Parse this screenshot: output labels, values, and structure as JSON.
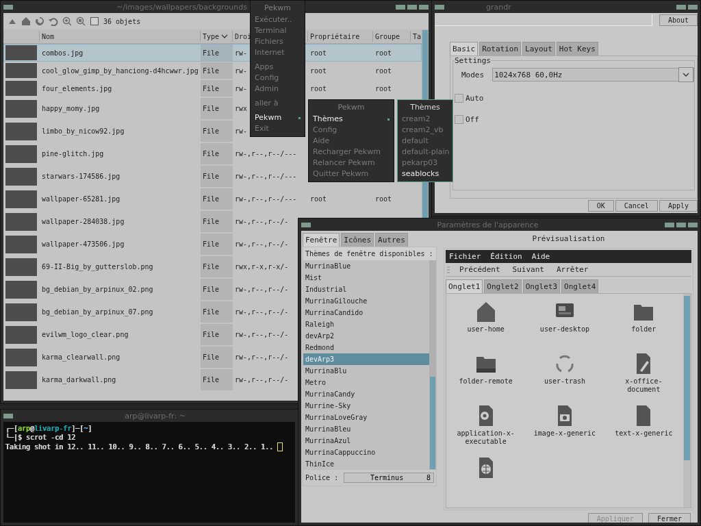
{
  "file_manager": {
    "title": "~/images/wallpapers/backgrounds",
    "count": "36 objets",
    "columns": [
      "Nom",
      "Type",
      "Droi",
      "Propriétaire",
      "Groupe",
      "Ta"
    ],
    "rows": [
      {
        "name": "combos.jpg",
        "type": "File",
        "rights": "rw-",
        "owner": "root",
        "group": "root",
        "selected": true
      },
      {
        "name": "cool_glow_gimp_by_hanciong-d4hcwwr.jpg",
        "type": "File",
        "rights": "rw-",
        "owner": "root",
        "group": "root",
        "selected": false
      },
      {
        "name": "four_elements.jpg",
        "type": "File",
        "rights": "rw-",
        "owner": "root",
        "group": "root",
        "selected": false
      },
      {
        "name": "happy_momy.jpg",
        "type": "File",
        "rights": "rwx",
        "selected": false
      },
      {
        "name": "limbo_by_nicow92.jpg",
        "type": "File",
        "rights": "rw-",
        "selected": false
      },
      {
        "name": "pine-glitch.jpg",
        "type": "File",
        "rights": "rw-,r--,r--/---",
        "selected": false
      },
      {
        "name": "starwars-174586.jpg",
        "type": "File",
        "rights": "rw-,r--,r--/---",
        "selected": false
      },
      {
        "name": "wallpaper-65281.jpg",
        "type": "File",
        "rights": "rw-,r--,r--/---",
        "owner": "root",
        "group": "root",
        "selected": false
      },
      {
        "name": "wallpaper-284038.jpg",
        "type": "File",
        "rights": "rw-,r--,r--/-",
        "selected": false
      },
      {
        "name": "wallpaper-473506.jpg",
        "type": "File",
        "rights": "rw-,r--,r--/-",
        "selected": false
      },
      {
        "name": "69-II-Big_by_gutterslob.png",
        "type": "File",
        "rights": "rwx,r-x,r-x/-",
        "selected": false
      },
      {
        "name": "bg_debian_by_arpinux_02.png",
        "type": "File",
        "rights": "rw-,r--,r--/-",
        "selected": false
      },
      {
        "name": "bg_debian_by_arpinux_07.png",
        "type": "File",
        "rights": "rw-,r--,r--/-",
        "selected": false
      },
      {
        "name": "evilwm_logo_clear.png",
        "type": "File",
        "rights": "rw-,r--,r--/-",
        "selected": false
      },
      {
        "name": "karma_clearwall.png",
        "type": "File",
        "rights": "rw-,r--,r--/-",
        "selected": false
      },
      {
        "name": "karma_darkwall.png",
        "type": "File",
        "rights": "rw-,r--,r--/-",
        "selected": false
      }
    ]
  },
  "root_menu": {
    "title": "Pekwm",
    "groups": [
      [
        {
          "label": "Exécuter..",
          "selected": false,
          "submenu": false
        },
        {
          "label": "Terminal",
          "selected": false,
          "submenu": false
        },
        {
          "label": "Fichiers",
          "selected": false,
          "submenu": false
        },
        {
          "label": "Internet",
          "selected": false,
          "submenu": false
        }
      ],
      [
        {
          "label": "Apps",
          "selected": false,
          "submenu": false
        },
        {
          "label": "Config",
          "selected": false,
          "submenu": false
        },
        {
          "label": "Admin",
          "selected": false,
          "submenu": false
        }
      ],
      [
        {
          "label": "aller à",
          "selected": false,
          "submenu": false
        }
      ],
      [
        {
          "label": "Pekwm",
          "selected": true,
          "submenu": true
        },
        {
          "label": "Exit",
          "selected": false,
          "submenu": false
        }
      ]
    ]
  },
  "pekwm_menu": {
    "title": "Pekwm",
    "groups": [
      [
        {
          "label": "Thèmes",
          "selected": true,
          "submenu": true
        },
        {
          "label": "Config",
          "selected": false,
          "submenu": false
        },
        {
          "label": "Aide",
          "selected": false,
          "submenu": false
        },
        {
          "label": "Recharger Pekwm",
          "selected": false,
          "submenu": false
        },
        {
          "label": "Relancer Pekwm",
          "selected": false,
          "submenu": false
        },
        {
          "label": "Quitter Pekwm",
          "selected": false,
          "submenu": false
        }
      ]
    ]
  },
  "themes_menu": {
    "title": "Thèmes",
    "groups": [
      [
        {
          "label": "cream2",
          "selected": false,
          "submenu": false
        },
        {
          "label": "cream2_vb",
          "selected": false,
          "submenu": false
        },
        {
          "label": "default",
          "selected": false,
          "submenu": false
        },
        {
          "label": "default-plain",
          "selected": false,
          "submenu": false
        },
        {
          "label": "pekarp03",
          "selected": false,
          "submenu": false
        },
        {
          "label": "seablocks",
          "selected": true,
          "submenu": false
        }
      ]
    ]
  },
  "grandr": {
    "title": "grandr",
    "about": "About",
    "tabs": [
      {
        "label": "Basic",
        "selected": true
      },
      {
        "label": "Rotation",
        "selected": false
      },
      {
        "label": "Layout",
        "selected": false
      },
      {
        "label": "Hot Keys",
        "selected": false
      }
    ],
    "group": "Settings",
    "modes_label": "Modes",
    "mode": "1024x768  60,0Hz",
    "checkboxes": [
      {
        "label": "Auto",
        "checked": false
      },
      {
        "label": "Off",
        "checked": false
      }
    ],
    "buttons": [
      "OK",
      "Cancel",
      "Apply"
    ]
  },
  "terminal": {
    "title": "arp@livarp-fr: ~",
    "lines": [
      {
        "cursor": false,
        "segments": [
          {
            "text": "┌─[",
            "color": "#d0d0d0"
          },
          {
            "text": "arp",
            "color": "#86d42a"
          },
          {
            "text": "@",
            "color": "#d0d0d0"
          },
          {
            "text": "livarp-fr",
            "color": "#1aa6ae"
          },
          {
            "text": "]─[",
            "color": "#d0d0d0"
          },
          {
            "text": "~",
            "color": "#6f9fe0"
          },
          {
            "text": "]",
            "color": "#d0d0d0"
          }
        ]
      },
      {
        "cursor": false,
        "segments": [
          {
            "text": "└─|$ scrot -cd 12",
            "color": "#d0d0d0"
          }
        ]
      },
      {
        "cursor": true,
        "segments": [
          {
            "text": "Taking shot in 12.. 11.. 10.. 9.. 8.. 7.. 6.. 5.. 4.. 3.. 2.. 1..",
            "color": "#d0d0d0"
          }
        ]
      }
    ]
  },
  "appearance": {
    "title": "Paramètres de l'apparence",
    "tabs": [
      {
        "label": "Fenêtre",
        "selected": true
      },
      {
        "label": "Icônes",
        "selected": false
      },
      {
        "label": "Autres",
        "selected": false
      }
    ],
    "list_header": "Thèmes de fenêtre disponibles :",
    "themes": [
      {
        "label": "MurrinaBlue",
        "selected": false
      },
      {
        "label": "Mist",
        "selected": false
      },
      {
        "label": "Industrial",
        "selected": false
      },
      {
        "label": "MurrinaGilouche",
        "selected": false
      },
      {
        "label": "MurrinaCandido",
        "selected": false
      },
      {
        "label": "Raleigh",
        "selected": false
      },
      {
        "label": "devArp2",
        "selected": false
      },
      {
        "label": "Redmond",
        "selected": false
      },
      {
        "label": "devArp3",
        "selected": true
      },
      {
        "label": "MurrinaBlu",
        "selected": false
      },
      {
        "label": "Metro",
        "selected": false
      },
      {
        "label": "MurrinaCandy",
        "selected": false
      },
      {
        "label": "Murrine-Sky",
        "selected": false
      },
      {
        "label": "MurrinaLoveGray",
        "selected": false
      },
      {
        "label": "MurrinaBleu",
        "selected": false
      },
      {
        "label": "MurrinaAzul",
        "selected": false
      },
      {
        "label": "MurrinaCappuccino",
        "selected": false
      },
      {
        "label": "ThinIce",
        "selected": false
      }
    ],
    "font_label": "Police :",
    "font_name": "Terminus",
    "font_size": "8",
    "preview": {
      "title": "Prévisualisation",
      "menu": [
        "Fichier",
        "Édition",
        "Aide"
      ],
      "toolbar": [
        "Précédent",
        "Suivant",
        "Arrêter"
      ],
      "tabs": [
        {
          "label": "Onglet1",
          "selected": true
        },
        {
          "label": "Onglet2",
          "selected": false
        },
        {
          "label": "Onglet3",
          "selected": false
        },
        {
          "label": "Onglet4",
          "selected": false
        }
      ],
      "icons": [
        "user-home",
        "user-desktop",
        "folder",
        "folder-remote",
        "user-trash",
        "x-office-document",
        "application-x-executable",
        "image-x-generic",
        "text-x-generic"
      ]
    },
    "buttons": [
      {
        "label": "Appliquer",
        "disabled": true
      },
      {
        "label": "Fermer",
        "disabled": false
      }
    ]
  }
}
